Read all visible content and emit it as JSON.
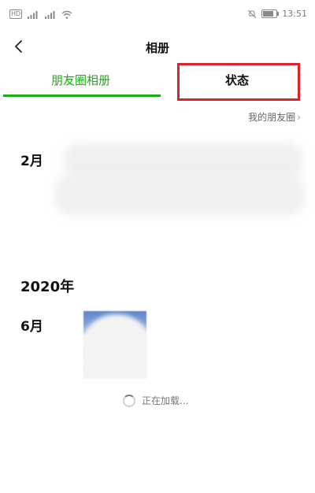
{
  "status_bar": {
    "hd": "HD",
    "time": "13:51"
  },
  "nav": {
    "title": "相册"
  },
  "tabs": [
    {
      "label": "朋友圈相册",
      "selected": true
    },
    {
      "label": "状态",
      "selected": false,
      "highlighted": true
    }
  ],
  "moments_link": {
    "label": "我的朋友圈"
  },
  "timeline": {
    "month_1": "2月",
    "year": "2020年",
    "month_2": "6月"
  },
  "loading": {
    "label": "正在加载..."
  },
  "colors": {
    "accent": "#1aad19",
    "highlight_border": "#d9252a"
  }
}
